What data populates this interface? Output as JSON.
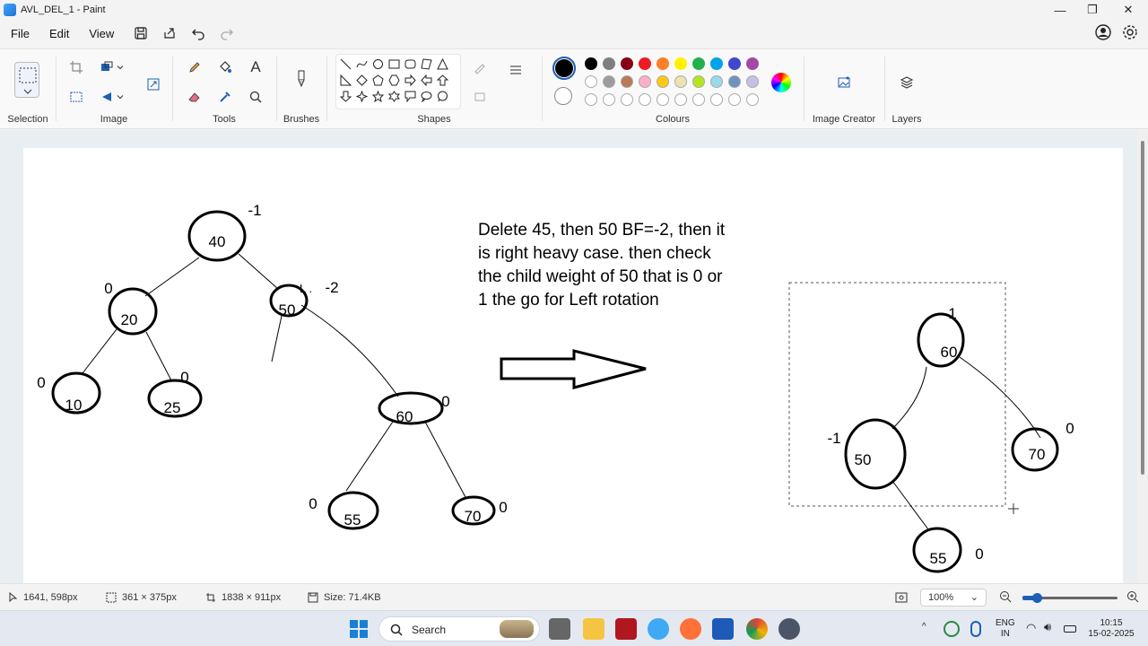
{
  "window": {
    "title": "AVL_DEL_1 - Paint",
    "min": "—",
    "max": "❐",
    "close": "✕"
  },
  "menu": {
    "file": "File",
    "edit": "Edit",
    "view": "View"
  },
  "ribbon": {
    "selection_label": "Selection",
    "image_label": "Image",
    "tools_label": "Tools",
    "brushes_label": "Brushes",
    "shapes_label": "Shapes",
    "colours_label": "Colours",
    "image_creator_label": "Image Creator",
    "layers_label": "Layers",
    "text_tool": "A",
    "colors_row1": [
      "#000000",
      "#7f7f7f",
      "#880015",
      "#ed1c24",
      "#ff7f27",
      "#fff200",
      "#22b14c",
      "#00a2e8",
      "#3f48cc",
      "#a349a4"
    ],
    "colors_row2": [
      "#ffffff",
      "#9c9c9c",
      "#b97a57",
      "#ffaec9",
      "#ffc90e",
      "#efe4b0",
      "#b5e61d",
      "#99d9ea",
      "#7092be",
      "#c8bfe7"
    ],
    "selected_color": "#000000",
    "secondary_color": "#ffffff"
  },
  "canvas": {
    "note_lines": [
      "Delete 45, then 50 BF=-2, then it",
      "is right heavy case. then check",
      "the child weight of 50 that is 0 or",
      "1 the go for Left rotation"
    ],
    "left_tree": {
      "n40": "40",
      "bf40": "-1",
      "n20": "20",
      "bf20": "0",
      "n50": "50",
      "bf50_mark": "L .",
      "bf50": "-2",
      "n10": "10",
      "bf10": "0",
      "n25": "25",
      "bf25": "0",
      "n60": "60",
      "bf60": "0",
      "n55": "55",
      "bf55": "0",
      "n70": "70",
      "bf70": "0"
    },
    "right_tree": {
      "n60": "60",
      "bf60": "1",
      "n50": "50",
      "bf50": "-1",
      "n70": "70",
      "bf70": "0",
      "n55": "55",
      "bf55": "0"
    }
  },
  "status": {
    "cursor": "1641, 598px",
    "selection_size": "361 × 375px",
    "canvas_size": "1838 × 911px",
    "file_size": "Size: 71.4KB",
    "zoom": "100%",
    "zoom_level": 0.5
  },
  "taskbar": {
    "search": "Search",
    "lang1": "ENG",
    "lang2": "IN",
    "time": "10:15",
    "date": "15-02-2025"
  }
}
